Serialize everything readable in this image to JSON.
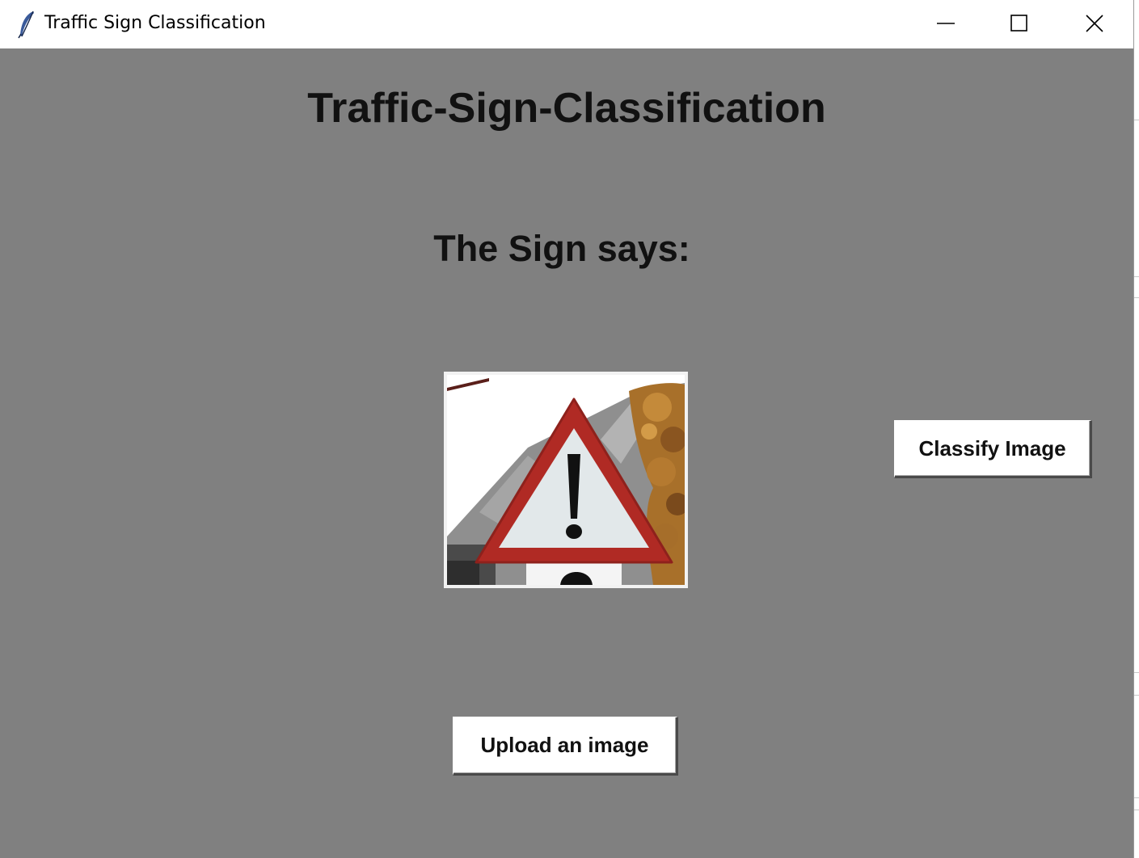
{
  "window": {
    "title": "Traffic Sign Classification",
    "app_icon": "feather-icon",
    "controls": {
      "minimize": "minimize-icon",
      "maximize": "maximize-icon",
      "close": "close-icon"
    }
  },
  "main": {
    "heading": "Traffic-Sign-Classification",
    "result_label": "The Sign says:",
    "image_description_icon": "warning-sign-image",
    "buttons": {
      "classify": "Classify Image",
      "upload": "Upload an image"
    }
  },
  "colors": {
    "window_background": "#808080",
    "titlebar_background": "#ffffff",
    "button_background": "#ffffff",
    "text": "#111111",
    "sign_red": "#b02a24"
  }
}
